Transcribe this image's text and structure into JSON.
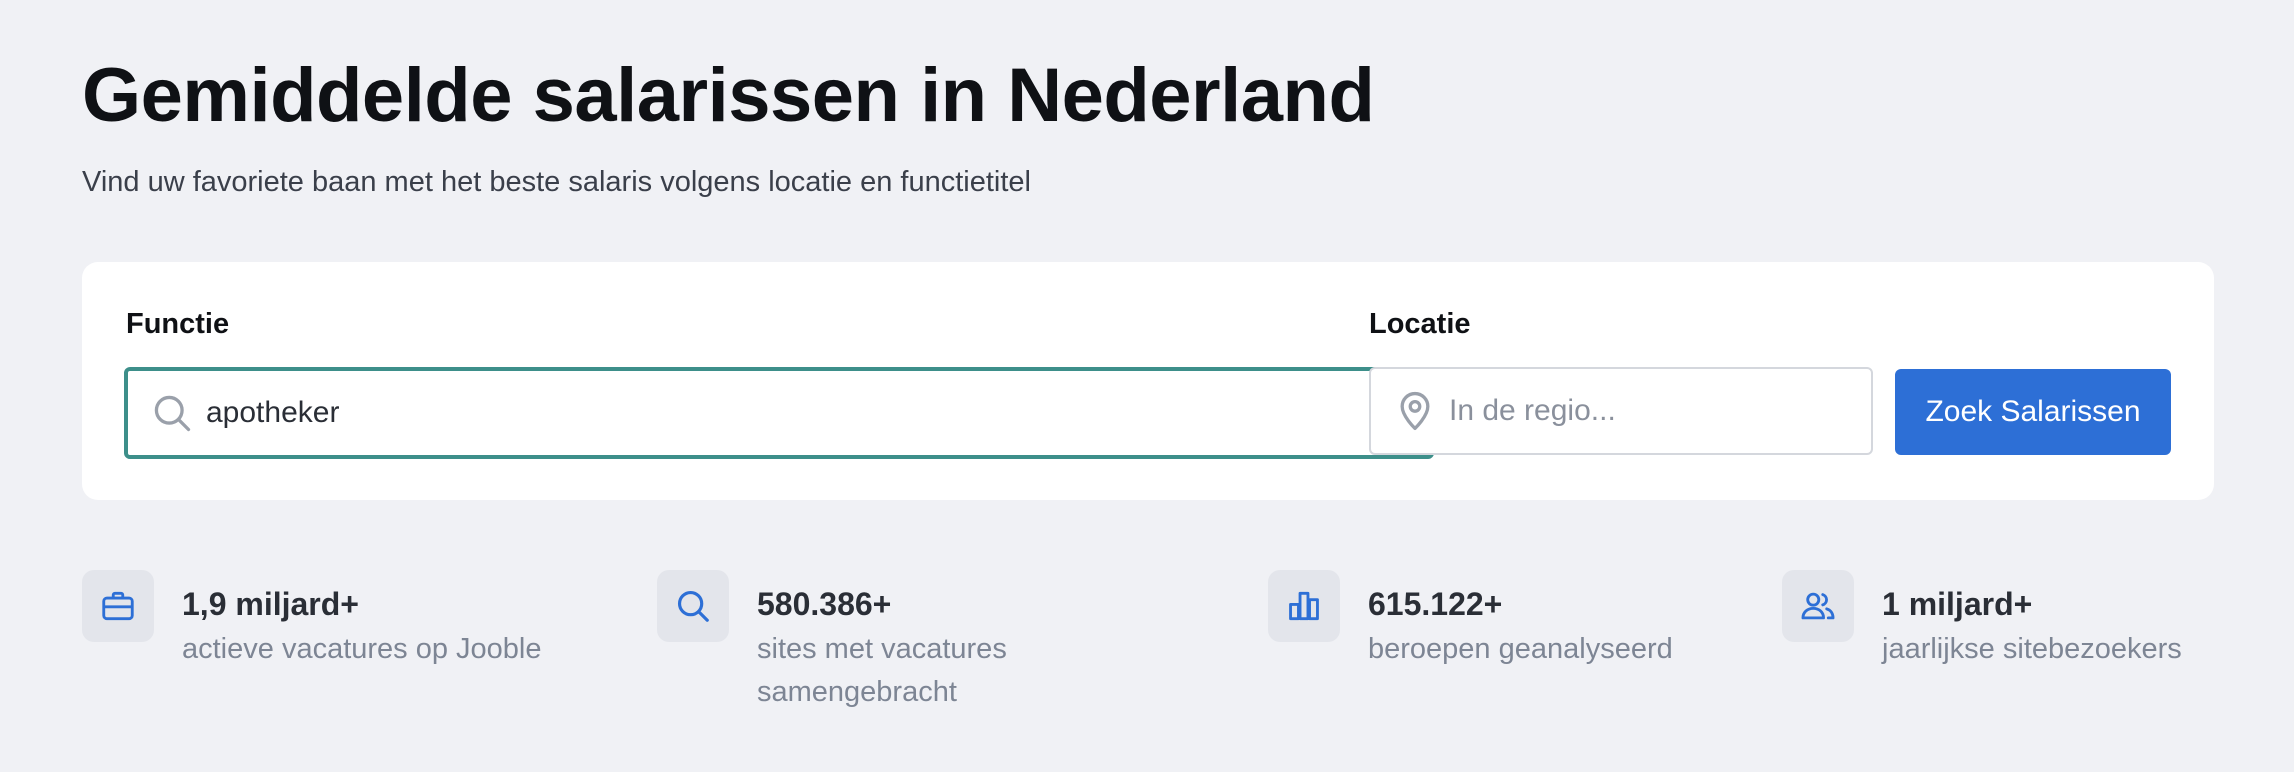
{
  "header": {
    "title": "Gemiddelde salarissen in Nederland",
    "subtitle": "Vind uw favoriete baan met het beste salaris volgens locatie en functietitel"
  },
  "search": {
    "function_label": "Functie",
    "function_value": "apotheker",
    "location_label": "Locatie",
    "location_placeholder": "In de regio...",
    "button_label": "Zoek Salarissen"
  },
  "stats": [
    {
      "icon": "briefcase-icon",
      "value": "1,9 miljard+",
      "label": "actieve vacatures op Jooble"
    },
    {
      "icon": "search-icon",
      "value": "580.386+",
      "label": "sites met vacatures samengebracht"
    },
    {
      "icon": "bar-chart-icon",
      "value": "615.122+",
      "label": "beroepen geanalyseerd"
    },
    {
      "icon": "users-icon",
      "value": "1 miljard+",
      "label": "jaarlijkse sitebezoekers"
    }
  ],
  "colors": {
    "background": "#f0f1f5",
    "accent_blue": "#2d6fd6",
    "focus_border": "#3d8f8a"
  }
}
